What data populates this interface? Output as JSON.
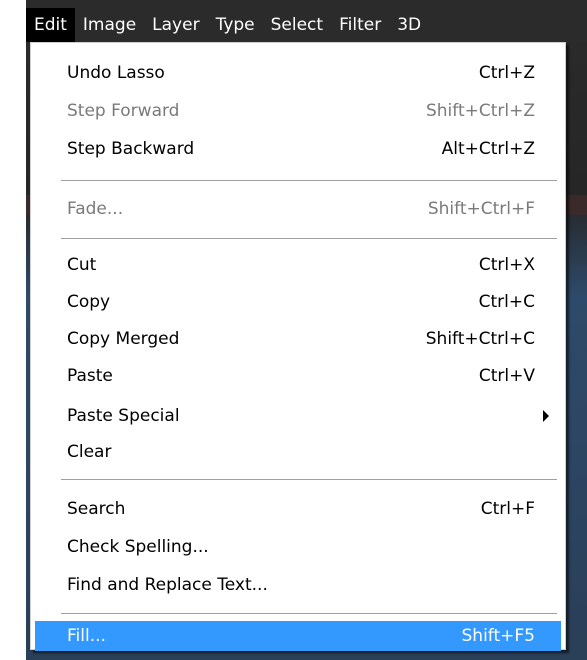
{
  "menubar": {
    "items": [
      {
        "label": "Edit",
        "active": true
      },
      {
        "label": "Image"
      },
      {
        "label": "Layer"
      },
      {
        "label": "Type"
      },
      {
        "label": "Select"
      },
      {
        "label": "Filter"
      },
      {
        "label": "3D"
      }
    ]
  },
  "edit_menu": {
    "items": [
      {
        "label": "Undo Lasso",
        "shortcut": "Ctrl+Z",
        "disabled": false
      },
      {
        "label": "Step Forward",
        "shortcut": "Shift+Ctrl+Z",
        "disabled": true
      },
      {
        "label": "Step Backward",
        "shortcut": "Alt+Ctrl+Z",
        "disabled": false
      },
      {
        "label": "Fade...",
        "shortcut": "Shift+Ctrl+F",
        "disabled": true
      },
      {
        "label": "Cut",
        "shortcut": "Ctrl+X",
        "disabled": false
      },
      {
        "label": "Copy",
        "shortcut": "Ctrl+C",
        "disabled": false
      },
      {
        "label": "Copy Merged",
        "shortcut": "Shift+Ctrl+C",
        "disabled": false
      },
      {
        "label": "Paste",
        "shortcut": "Ctrl+V",
        "disabled": false
      },
      {
        "label": "Paste Special",
        "shortcut": "",
        "disabled": false,
        "submenu": true
      },
      {
        "label": "Clear",
        "shortcut": "",
        "disabled": false
      },
      {
        "label": "Search",
        "shortcut": "Ctrl+F",
        "disabled": false
      },
      {
        "label": "Check Spelling...",
        "shortcut": "",
        "disabled": false
      },
      {
        "label": "Find and Replace Text...",
        "shortcut": "",
        "disabled": false
      },
      {
        "label": "Fill...",
        "shortcut": "Shift+F5",
        "disabled": false,
        "highlighted": true
      }
    ]
  },
  "colors": {
    "highlight": "#3399ff",
    "disabled_text": "#7a7a7a",
    "menubar_bg": "#2b2b2b"
  }
}
